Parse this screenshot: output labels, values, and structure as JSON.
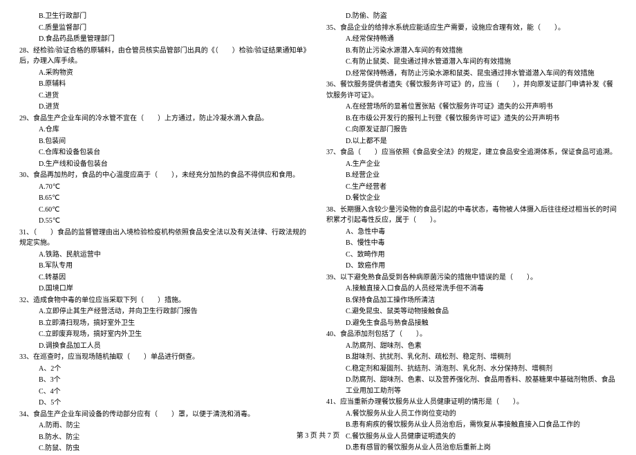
{
  "left": [
    {
      "cls": "opt",
      "t": "B.卫生行政部门"
    },
    {
      "cls": "opt",
      "t": "C.质量监督部门"
    },
    {
      "cls": "opt",
      "t": "D.食品药品质量管理部门"
    },
    {
      "cls": "stem",
      "t": "28、经检验/验证合格的原辅料，由仓管员核实品管部门出具的《（　　）检验/验证结果通知单》后，办理入库手续。"
    },
    {
      "cls": "opt",
      "t": "A.采购物资"
    },
    {
      "cls": "opt",
      "t": "B.原辅料"
    },
    {
      "cls": "opt",
      "t": "C.进货"
    },
    {
      "cls": "opt",
      "t": "D.进货"
    },
    {
      "cls": "stem",
      "t": "29、食品生产企业车间的冷水管不宜在（　　）上方通过，防止冷凝水滴入食品。"
    },
    {
      "cls": "opt",
      "t": "A.仓库"
    },
    {
      "cls": "opt",
      "t": "B.包装间"
    },
    {
      "cls": "opt",
      "t": "C.仓库和设备包装台"
    },
    {
      "cls": "opt",
      "t": "D.生产线和设备包装台"
    },
    {
      "cls": "stem",
      "t": "30、食品再加热时，食品的中心温度应高于（　　），未经充分加热的食品不得供应和食用。"
    },
    {
      "cls": "opt",
      "t": "A.70℃"
    },
    {
      "cls": "opt",
      "t": "B.65℃"
    },
    {
      "cls": "opt",
      "t": "C.60℃"
    },
    {
      "cls": "opt",
      "t": "D.55℃"
    },
    {
      "cls": "stem",
      "t": "31、（　　）食品的监督管理由出入境检验检疫机构依照食品安全法以及有关法律、行政法规的规定实施。"
    },
    {
      "cls": "opt",
      "t": "A.铁路、民航运营中"
    },
    {
      "cls": "opt",
      "t": "B.军队专用"
    },
    {
      "cls": "opt",
      "t": "C.转基因"
    },
    {
      "cls": "opt",
      "t": "D.国境口岸"
    },
    {
      "cls": "stem",
      "t": "32、造成食物中毒的单位应当采取下列（　　）措施。"
    },
    {
      "cls": "opt",
      "t": "A.立即停止其生产经营活动，并向卫生行政部门报告"
    },
    {
      "cls": "opt",
      "t": "B.立即清扫现场，搞好室外卫生"
    },
    {
      "cls": "opt",
      "t": "C.立即废弃现场，搞好室内外卫生"
    },
    {
      "cls": "opt",
      "t": "D.调换食品加工人员"
    },
    {
      "cls": "stem",
      "t": "33、在巡查时，应当现场随机抽取（　　）单品进行倒查。"
    },
    {
      "cls": "opt",
      "t": "A、2个"
    },
    {
      "cls": "opt",
      "t": "B、3个"
    },
    {
      "cls": "opt",
      "t": "C、4个"
    },
    {
      "cls": "opt",
      "t": "D、5个"
    },
    {
      "cls": "stem",
      "t": "34、食品生产企业车间设备的传动部分应有（　　）罩，以便于清洗和消毒。"
    },
    {
      "cls": "opt",
      "t": "A.防雨、防尘"
    },
    {
      "cls": "opt",
      "t": "B.防水、防尘"
    },
    {
      "cls": "opt",
      "t": "C.防鼠、防虫"
    }
  ],
  "right": [
    {
      "cls": "opt",
      "t": "D.防偷、防盗"
    },
    {
      "cls": "stem",
      "t": "35、食品企业的给排水系统应能适应生产需要，设施应合理有效，能（　　）。"
    },
    {
      "cls": "opt",
      "t": "A.经常保持畅通"
    },
    {
      "cls": "opt",
      "t": "B.有防止污染水源潜入车间的有效措施"
    },
    {
      "cls": "opt",
      "t": "C.有防止鼠类、昆虫通过排水管道潜入车间的有效措施"
    },
    {
      "cls": "opt",
      "t": "D.经常保持畅通，有防止污染水源和鼠类、昆虫通过排水管道潜入车间的有效措施"
    },
    {
      "cls": "stem",
      "t": "36、餐饮服务提供者遗失《餐饮服务许可证》的，应当（　　），并向原发证部门申请补发《餐饮服务许可证》。"
    },
    {
      "cls": "opt",
      "t": "A.在经营场所的显着位置张贴《餐饮服务许可证》遗失的公开声明书"
    },
    {
      "cls": "opt",
      "t": "B.在市级公开发行的报刊上刊登《餐饮服务许可证》遗失的公开声明书"
    },
    {
      "cls": "opt",
      "t": "C.向原发证部门报告"
    },
    {
      "cls": "opt",
      "t": "D.以上都不是"
    },
    {
      "cls": "stem",
      "t": "37、食品（　　）应当依照《食品安全法》的规定，建立食品安全追溯体系，保证食品可追溯。"
    },
    {
      "cls": "opt",
      "t": "A.生产企业"
    },
    {
      "cls": "opt",
      "t": "B.经营企业"
    },
    {
      "cls": "opt",
      "t": "C.生产经营者"
    },
    {
      "cls": "opt",
      "t": "D.餐饮企业"
    },
    {
      "cls": "stem",
      "t": "38、长期摄入含较少量污染物的食品引起的中毒状态，毒物被人体摄入后往往经过相当长的时间积累才引起毒性反应，属于（　　）。"
    },
    {
      "cls": "opt",
      "t": "A、急性中毒"
    },
    {
      "cls": "opt",
      "t": "B、慢性中毒"
    },
    {
      "cls": "opt",
      "t": "C、致畸作用"
    },
    {
      "cls": "opt",
      "t": "D、致癌作用"
    },
    {
      "cls": "stem",
      "t": "39、以下避免熟食品受到各种病原菌污染的措施中错误的是（　　）。"
    },
    {
      "cls": "opt",
      "t": "A.接触直接入口食品的人员经常洗手但不消毒"
    },
    {
      "cls": "opt",
      "t": "B.保持食品加工操作场所清洁"
    },
    {
      "cls": "opt",
      "t": "C.避免昆虫、鼠类等动物接触食品"
    },
    {
      "cls": "opt",
      "t": "D.避免生食品与熟食品接触"
    },
    {
      "cls": "stem",
      "t": "40、食品添加剂包括了（　　）。"
    },
    {
      "cls": "opt",
      "t": "A.防腐剂、甜味剂、色素"
    },
    {
      "cls": "opt",
      "t": "B.甜味剂、抗扰剂、乳化剂、疏松剂、稳定剂、增稠剂"
    },
    {
      "cls": "opt",
      "t": "C.稳定剂和凝固剂、抗结剂、消泡剂、乳化剂、水分保持剂、增稠剂"
    },
    {
      "cls": "opt",
      "t": "D.防腐剂、甜味剂、色素、以及营养强化剂、食品用香料、胶基糖果中基础剂物质、食品工业用加工助剂等"
    },
    {
      "cls": "stem",
      "t": "41、应当重新办理餐饮服务从业人员健康证明的情形是（　　）。"
    },
    {
      "cls": "opt",
      "t": "A.餐饮服务从业人员工作岗位变动的"
    },
    {
      "cls": "opt",
      "t": "B.患有痢疾的餐饮服务从业人员治愈后，需恢复从事接触直接入口食品工作的"
    },
    {
      "cls": "opt",
      "t": "C.餐饮服务从业人员健康证明遗失的"
    },
    {
      "cls": "opt",
      "t": "D.患有感冒的餐饮服务从业人员治愈后重新上岗"
    }
  ],
  "footer": "第 3 页 共 7 页"
}
